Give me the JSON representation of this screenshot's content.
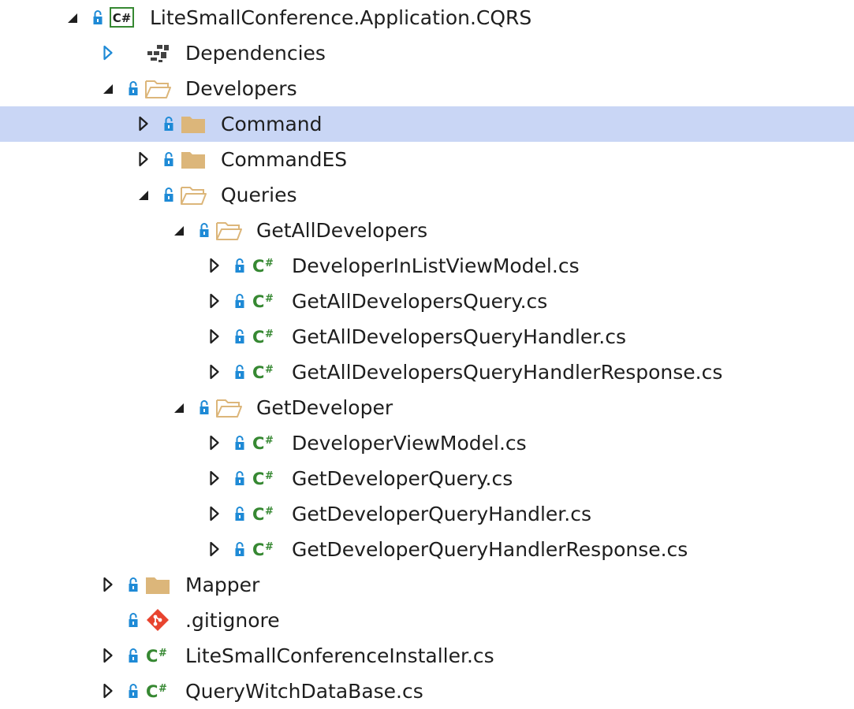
{
  "tree": {
    "items": [
      {
        "label": "LiteSmallConference.Application.CQRS",
        "level": 0,
        "expander": "expanded",
        "icon": "csproj-icon",
        "lock": true
      },
      {
        "label": "Dependencies",
        "level": 1,
        "expander": "collapsed-blue",
        "icon": "dependencies-icon",
        "lock": false
      },
      {
        "label": "Developers",
        "level": 1,
        "expander": "expanded",
        "icon": "folder-open-icon",
        "lock": true
      },
      {
        "label": "Command",
        "level": 2,
        "expander": "collapsed",
        "icon": "folder-icon",
        "lock": true,
        "selected": true
      },
      {
        "label": "CommandES",
        "level": 2,
        "expander": "collapsed",
        "icon": "folder-icon",
        "lock": true
      },
      {
        "label": "Queries",
        "level": 2,
        "expander": "expanded",
        "icon": "folder-open-icon",
        "lock": true
      },
      {
        "label": "GetAllDevelopers",
        "level": 3,
        "expander": "expanded",
        "icon": "folder-open-icon",
        "lock": true
      },
      {
        "label": "DeveloperInListViewModel.cs",
        "level": 4,
        "expander": "collapsed",
        "icon": "csharp-file-icon",
        "lock": true
      },
      {
        "label": "GetAllDevelopersQuery.cs",
        "level": 4,
        "expander": "collapsed",
        "icon": "csharp-file-icon",
        "lock": true
      },
      {
        "label": "GetAllDevelopersQueryHandler.cs",
        "level": 4,
        "expander": "collapsed",
        "icon": "csharp-file-icon",
        "lock": true
      },
      {
        "label": "GetAllDevelopersQueryHandlerResponse.cs",
        "level": 4,
        "expander": "collapsed",
        "icon": "csharp-file-icon",
        "lock": true
      },
      {
        "label": "GetDeveloper",
        "level": 3,
        "expander": "expanded",
        "icon": "folder-open-icon",
        "lock": true
      },
      {
        "label": "DeveloperViewModel.cs",
        "level": 4,
        "expander": "collapsed",
        "icon": "csharp-file-icon",
        "lock": true
      },
      {
        "label": "GetDeveloperQuery.cs",
        "level": 4,
        "expander": "collapsed",
        "icon": "csharp-file-icon",
        "lock": true
      },
      {
        "label": "GetDeveloperQueryHandler.cs",
        "level": 4,
        "expander": "collapsed",
        "icon": "csharp-file-icon",
        "lock": true
      },
      {
        "label": "GetDeveloperQueryHandlerResponse.cs",
        "level": 4,
        "expander": "collapsed",
        "icon": "csharp-file-icon",
        "lock": true
      },
      {
        "label": "Mapper",
        "level": 1,
        "expander": "collapsed",
        "icon": "folder-icon",
        "lock": true
      },
      {
        "label": ".gitignore",
        "level": 1,
        "expander": "none",
        "icon": "git-icon",
        "lock": true
      },
      {
        "label": "LiteSmallConferenceInstaller.cs",
        "level": 1,
        "expander": "collapsed",
        "icon": "csharp-file-icon",
        "lock": true
      },
      {
        "label": "QueryWitchDataBase.cs",
        "level": 1,
        "expander": "collapsed",
        "icon": "csharp-file-icon",
        "lock": true
      }
    ]
  },
  "colors": {
    "selection": "#c9d6f5",
    "lock": "#1e8ad6",
    "csharp": "#368832",
    "folder": "#dcb67a",
    "git": "#e8442f",
    "expander_blue": "#1e8ad6"
  }
}
